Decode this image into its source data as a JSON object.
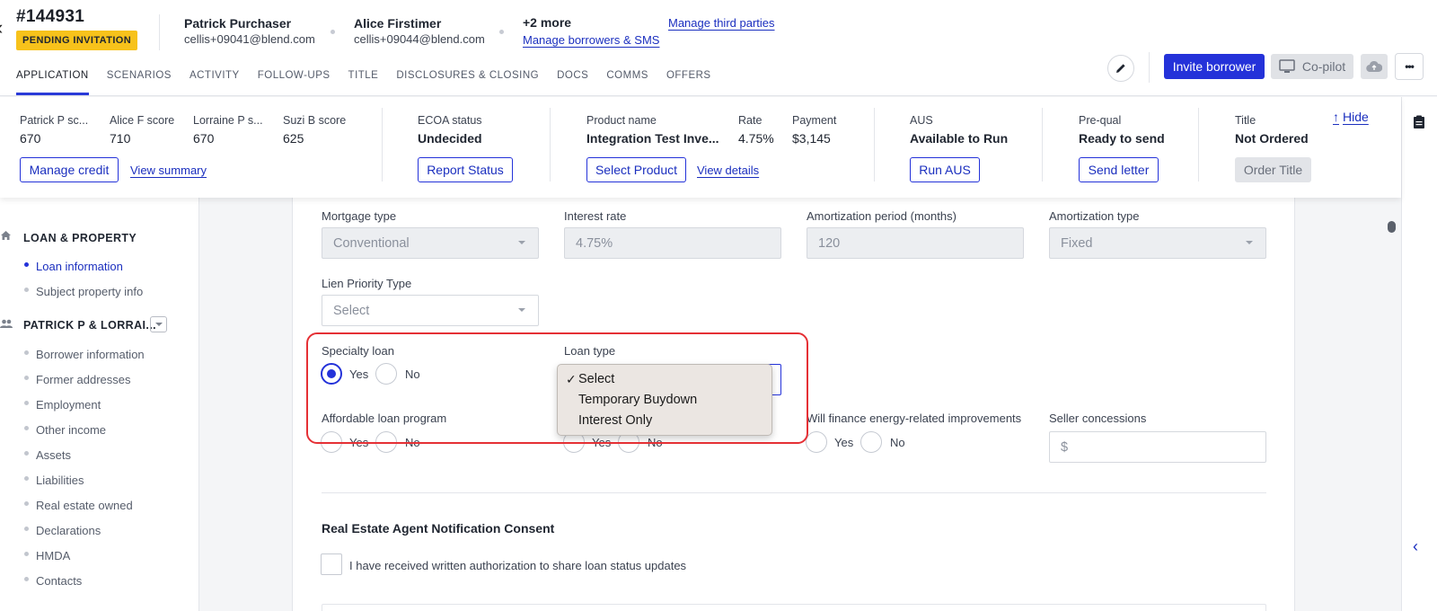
{
  "header": {
    "back_glyph": "‹",
    "loan_id": "#144931",
    "status_badge": "PENDING INVITATION",
    "borrowers": [
      {
        "name": "Patrick Purchaser",
        "email": "cellis+09041@blend.com"
      },
      {
        "name": "Alice Firstimer",
        "email": "cellis+09044@blend.com"
      }
    ],
    "more_label": "+2 more",
    "manage_borrowers_link": "Manage borrowers & SMS",
    "manage_third_parties_link": "Manage third parties",
    "invite_button": "Invite borrower",
    "copilot_button": "Co-pilot",
    "more_glyph": "•••"
  },
  "tabs": [
    {
      "label": "APPLICATION",
      "active": true
    },
    {
      "label": "SCENARIOS"
    },
    {
      "label": "ACTIVITY"
    },
    {
      "label": "FOLLOW-UPS"
    },
    {
      "label": "TITLE"
    },
    {
      "label": "DISCLOSURES & CLOSING"
    },
    {
      "label": "DOCS"
    },
    {
      "label": "COMMS"
    },
    {
      "label": "OFFERS"
    }
  ],
  "summary": {
    "scores": [
      {
        "label": "Patrick P sc...",
        "value": "670"
      },
      {
        "label": "Alice F score",
        "value": "710"
      },
      {
        "label": "Lorraine P s...",
        "value": "670"
      },
      {
        "label": "Suzi B score",
        "value": "625"
      }
    ],
    "manage_credit": "Manage credit",
    "view_summary": "View summary",
    "ecoa_label": "ECOA status",
    "ecoa_value": "Undecided",
    "report_status": "Report Status",
    "product_label": "Product name",
    "product_value": "Integration Test Inve...",
    "rate_label": "Rate",
    "rate_value": "4.75%",
    "payment_label": "Payment",
    "payment_value": "$3,145",
    "select_product": "Select Product",
    "view_details": "View details",
    "aus_label": "AUS",
    "aus_value": "Available to Run",
    "run_aus": "Run AUS",
    "prequal_label": "Pre-qual",
    "prequal_value": "Ready to send",
    "send_letter": "Send letter",
    "title_label": "Title",
    "title_value": "Not Ordered",
    "order_title": "Order Title",
    "hide": "Hide"
  },
  "sidebar": {
    "section1": "LOAN & PROPERTY",
    "section1_items": [
      {
        "label": "Loan information",
        "active": true
      },
      {
        "label": "Subject property info"
      }
    ],
    "section2": "PATRICK P & LORRAI...",
    "section2_items": [
      {
        "label": "Borrower information"
      },
      {
        "label": "Former addresses"
      },
      {
        "label": "Employment"
      },
      {
        "label": "Other income"
      },
      {
        "label": "Assets"
      },
      {
        "label": "Liabilities"
      },
      {
        "label": "Real estate owned"
      },
      {
        "label": "Declarations"
      },
      {
        "label": "HMDA"
      },
      {
        "label": "Contacts"
      }
    ]
  },
  "form": {
    "mortgage_type_label": "Mortgage type",
    "mortgage_type_value": "Conventional",
    "interest_rate_label": "Interest rate",
    "interest_rate_value": "4.75%",
    "amortization_period_label": "Amortization period (months)",
    "amortization_period_value": "120",
    "amortization_type_label": "Amortization type",
    "amortization_type_value": "Fixed",
    "lien_label": "Lien Priority Type",
    "lien_value": "Select",
    "specialty_label": "Specialty loan",
    "yes": "Yes",
    "no": "No",
    "loan_type_label": "Loan type",
    "affordable_label": "Affordable loan program",
    "energy_label": "Will finance energy-related improvements",
    "seller_label": "Seller concessions",
    "seller_prefix": "$",
    "consent_heading": "Real Estate Agent Notification Consent",
    "consent_text": "I have received written authorization to share loan status updates"
  },
  "dropdown": {
    "check": "✓",
    "options": [
      "Select",
      "Temporary Buydown",
      "Interest Only"
    ],
    "selected": "Select"
  }
}
